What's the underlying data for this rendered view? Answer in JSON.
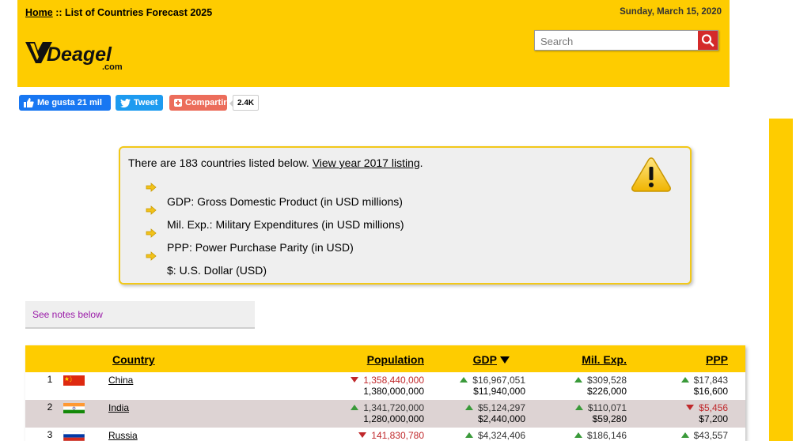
{
  "header": {
    "home_link": "Home",
    "separator": " :: ",
    "page_title": "List of Countries Forecast 2025",
    "date": "Sunday, March 15, 2020",
    "logo_text": "Deagel",
    "logo_suffix": ".com",
    "search_placeholder": "Search"
  },
  "social": {
    "like_label": "Me gusta 21 mil",
    "tweet_label": "Tweet",
    "share_label": "Compartir",
    "share_count": "2.4K"
  },
  "info": {
    "intro_text": "There are 183 countries listed below. ",
    "view_link": "View year 2017 listing",
    "intro_end": ".",
    "legend": [
      "GDP: Gross Domestic Product (in USD millions)",
      "Mil. Exp.: Military Expenditures (in USD millions)",
      "PPP: Power Purchase Parity (in USD)",
      "$: U.S. Dollar (USD)"
    ]
  },
  "notes_link": "See notes below",
  "table": {
    "headers": {
      "country": "Country",
      "population": "Population",
      "gdp": "GDP",
      "milexp": "Mil. Exp.",
      "ppp": "PPP"
    },
    "rows": [
      {
        "rank": "1",
        "country": "China",
        "flag": "china",
        "pop": [
          "1,358,440,000",
          "1,380,000,000"
        ],
        "pop_dir": "down",
        "gdp": [
          "$16,967,051",
          "$11,940,000"
        ],
        "gdp_dir": "up",
        "mil": [
          "$309,528",
          "$226,000"
        ],
        "mil_dir": "up",
        "ppp": [
          "$17,843",
          "$16,600"
        ],
        "ppp_dir": "up"
      },
      {
        "rank": "2",
        "country": "India",
        "flag": "india",
        "pop": [
          "1,341,720,000",
          "1,280,000,000"
        ],
        "pop_dir": "up",
        "gdp": [
          "$5,124,297",
          "$2,440,000"
        ],
        "gdp_dir": "up",
        "mil": [
          "$110,071",
          "$59,280"
        ],
        "mil_dir": "up",
        "ppp": [
          "$5,456",
          "$7,200"
        ],
        "ppp_dir": "down"
      },
      {
        "rank": "3",
        "country": "Russia",
        "flag": "russia",
        "pop": [
          "141,830,780",
          ""
        ],
        "pop_dir": "down",
        "gdp": [
          "$4,324,406",
          ""
        ],
        "gdp_dir": "up",
        "mil": [
          "$186,146",
          ""
        ],
        "mil_dir": "up",
        "ppp": [
          "$43,557",
          ""
        ],
        "ppp_dir": "up"
      }
    ]
  },
  "colors": {
    "brand_yellow": "#fecc00",
    "up": "#3a9a3a",
    "down": "#c0282b",
    "row_alt": "#ddd3d3"
  }
}
